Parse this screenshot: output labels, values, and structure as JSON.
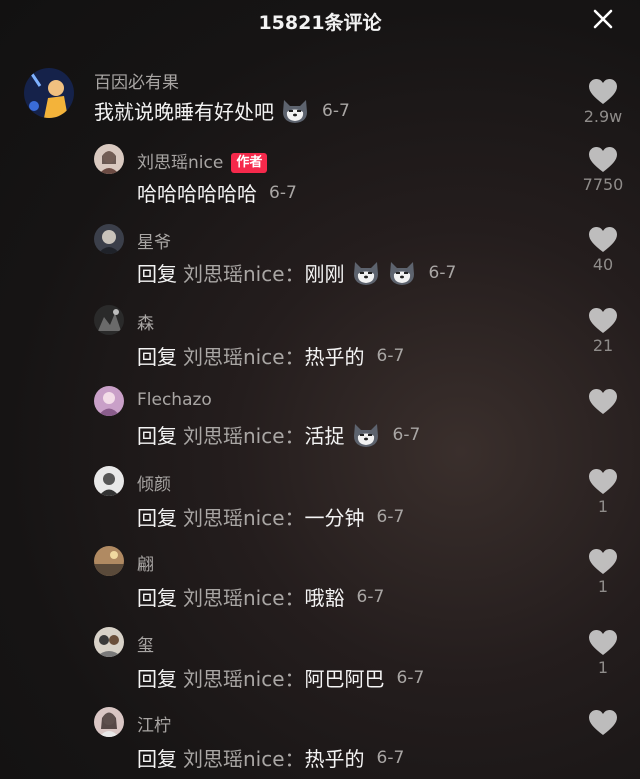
{
  "header": {
    "title": "15821条评论"
  },
  "comments": [
    {
      "user": "百因必有果",
      "badge": "",
      "reply_prefix": "",
      "reply_target": "",
      "body": "我就说晚睡有好处吧",
      "emojis": 1,
      "date": "6-7",
      "likes": "2.9w"
    },
    {
      "user": "刘思瑶nice",
      "badge": "作者",
      "reply_prefix": "",
      "reply_target": "",
      "body": "哈哈哈哈哈哈",
      "emojis": 0,
      "date": "6-7",
      "likes": "7750"
    },
    {
      "user": "星爷",
      "badge": "",
      "reply_prefix": "回复",
      "reply_target": "刘思瑶nice：",
      "body": "刚刚",
      "emojis": 2,
      "date": "6-7",
      "likes": "40"
    },
    {
      "user": "森",
      "badge": "",
      "reply_prefix": "回复",
      "reply_target": "刘思瑶nice：",
      "body": "热乎的",
      "emojis": 0,
      "date": "6-7",
      "likes": "21"
    },
    {
      "user": "Flechazo",
      "badge": "",
      "reply_prefix": "回复",
      "reply_target": "刘思瑶nice：",
      "body": "活捉",
      "emojis": 1,
      "date": "6-7",
      "likes": ""
    },
    {
      "user": "倾颜",
      "badge": "",
      "reply_prefix": "回复",
      "reply_target": "刘思瑶nice：",
      "body": "一分钟",
      "emojis": 0,
      "date": "6-7",
      "likes": "1"
    },
    {
      "user": "翩",
      "badge": "",
      "reply_prefix": "回复",
      "reply_target": "刘思瑶nice：",
      "body": "哦豁",
      "emojis": 0,
      "date": "6-7",
      "likes": "1"
    },
    {
      "user": "玺",
      "badge": "",
      "reply_prefix": "回复",
      "reply_target": "刘思瑶nice：",
      "body": "阿巴阿巴",
      "emojis": 0,
      "date": "6-7",
      "likes": "1"
    },
    {
      "user": "江柠",
      "badge": "",
      "reply_prefix": "回复",
      "reply_target": "刘思瑶nice：",
      "body": "热乎的",
      "emojis": 0,
      "date": "6-7",
      "likes": ""
    }
  ],
  "icons": {
    "close": "close-icon",
    "like": "heart-icon",
    "emoji": "husky-emoji-icon"
  },
  "colors": {
    "background": "#1a1717",
    "badge": "#f5294b",
    "muted_text": "#a9a6a4",
    "heart": "#d9d9d9"
  }
}
